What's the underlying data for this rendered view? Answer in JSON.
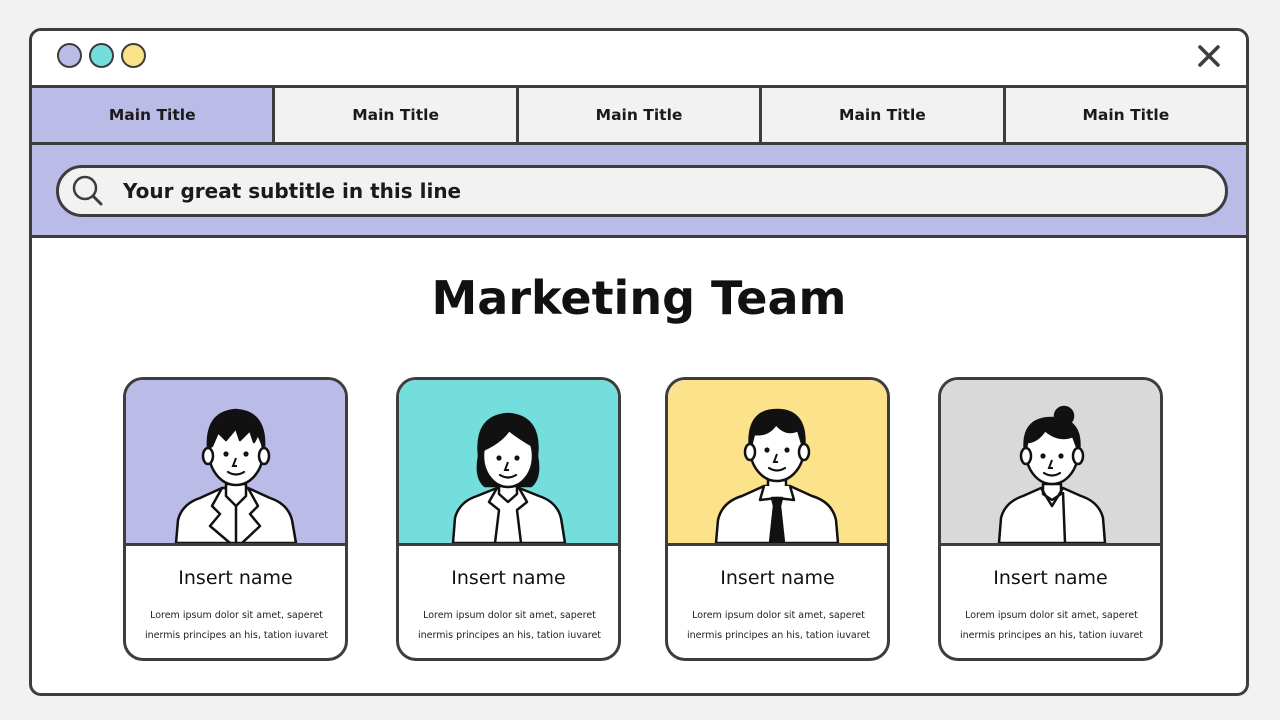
{
  "window": {
    "dots": [
      {
        "color": "#babbe6"
      },
      {
        "color": "#74dedc"
      },
      {
        "color": "#fbe28b"
      }
    ],
    "close_icon": "close-icon"
  },
  "tabs": [
    {
      "label": "Main Title",
      "active": true
    },
    {
      "label": "Main Title",
      "active": false
    },
    {
      "label": "Main Title",
      "active": false
    },
    {
      "label": "Main Title",
      "active": false
    },
    {
      "label": "Main Title",
      "active": false
    }
  ],
  "search": {
    "icon": "search-icon",
    "text": "Your great subtitle in this line"
  },
  "main": {
    "title": "Marketing Team",
    "cards": [
      {
        "name": "Insert name",
        "desc_line1": "Lorem ipsum dolor sit amet, saperet",
        "desc_line2": "inermis principes an his, tation iuvaret",
        "color": "#babbe6",
        "avatar": "man-avatar-icon"
      },
      {
        "name": "Insert name",
        "desc_line1": "Lorem ipsum dolor sit amet, saperet",
        "desc_line2": "inermis principes an his, tation iuvaret",
        "color": "#74dedc",
        "avatar": "woman-avatar-icon"
      },
      {
        "name": "Insert name",
        "desc_line1": "Lorem ipsum dolor sit amet, saperet",
        "desc_line2": "inermis principes an his, tation iuvaret",
        "color": "#fbe28b",
        "avatar": "man-tie-avatar-icon"
      },
      {
        "name": "Insert name",
        "desc_line1": "Lorem ipsum dolor sit amet, saperet",
        "desc_line2": "inermis principes an his, tation iuvaret",
        "color": "#d9d9d9",
        "avatar": "woman-bun-avatar-icon"
      }
    ]
  }
}
